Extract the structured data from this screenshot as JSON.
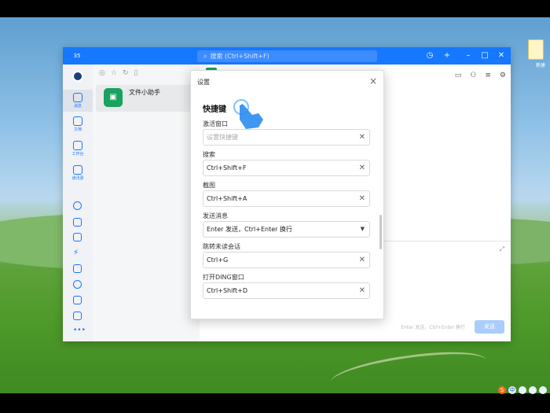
{
  "desktop": {
    "file_label": "新建"
  },
  "window": {
    "badge": "35",
    "search_placeholder": "搜索 (Ctrl+Shift+F)",
    "titlebar_buttons": [
      "history-icon",
      "plus-icon",
      "minimize-icon",
      "maximize-icon",
      "close-icon"
    ]
  },
  "nav": {
    "items": [
      {
        "label": "消息",
        "icon": "message-icon"
      },
      {
        "label": "文档",
        "icon": "doc-icon"
      },
      {
        "label": "工作台",
        "icon": "workbench-icon"
      },
      {
        "label": "通讯录",
        "icon": "contacts-icon"
      }
    ]
  },
  "conversations": [
    {
      "name": "文件小助手",
      "icon": "folder-icon"
    }
  ],
  "chat": {
    "input_hint": "Enter 发送，Ctrl+Enter 换行",
    "send_label": "发送"
  },
  "dialog": {
    "title": "设置",
    "section_title": "快捷键",
    "fields": [
      {
        "label": "激活窗口",
        "value": "",
        "placeholder": "设置快捷键",
        "type": "text"
      },
      {
        "label": "搜索",
        "value": "Ctrl+Shift+F",
        "type": "text"
      },
      {
        "label": "截图",
        "value": "Ctrl+Shift+A",
        "type": "text"
      },
      {
        "label": "发送消息",
        "value": "Enter 发送，Ctrl+Enter 换行",
        "type": "select"
      },
      {
        "label": "跳转未读会话",
        "value": "Ctrl+G",
        "type": "text"
      },
      {
        "label": "打开DING窗口",
        "value": "Ctrl+Shift+D",
        "type": "text"
      }
    ]
  },
  "colors": {
    "accent": "#1677ff",
    "send_disabled": "#a9cdfd",
    "green_avatar": "#1aa260"
  }
}
